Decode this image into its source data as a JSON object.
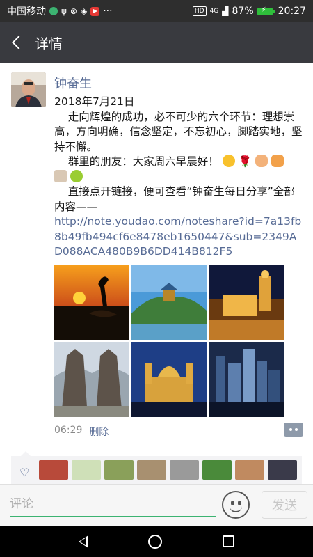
{
  "status_bar": {
    "carrier": "中国移动",
    "network": "4G",
    "hd": "HD",
    "battery": "87%",
    "time": "20:27",
    "more": "···"
  },
  "nav": {
    "title": "详情"
  },
  "post": {
    "author": "钟奋生",
    "date_line": "2018年7月21日",
    "para1": "    走向辉煌的成功，必不可少的六个环节：理想崇高，方向明确，信念坚定，不忘初心，脚踏实地，坚持不懈。",
    "para2": "    群里的朋友：大家周六早晨好！",
    "para3": "    直接点开链接，便可查看“钟奋生每日分享”全部内容——",
    "link": "http://note.youdao.com/noteshare?id=7a13fb8b49fb494cf6e8478eb1650447&sub=2349AD088ACA480B9B6DD414B812F5",
    "time": "06:29",
    "delete_label": "删除",
    "images": [
      {
        "name": "crane-sunset"
      },
      {
        "name": "pagoda-hill"
      },
      {
        "name": "castle-night"
      },
      {
        "name": "bali-gate"
      },
      {
        "name": "cathedral-night"
      },
      {
        "name": "city-night"
      }
    ]
  },
  "likes": {
    "avatar_count": 8
  },
  "comment_bar": {
    "placeholder": "评论",
    "send_label": "发送"
  },
  "colors": {
    "link_blue": "#576b95",
    "nav_bg": "#393a3f",
    "status_bg": "#2e2e2e",
    "wechat_green": "#3cb371"
  }
}
